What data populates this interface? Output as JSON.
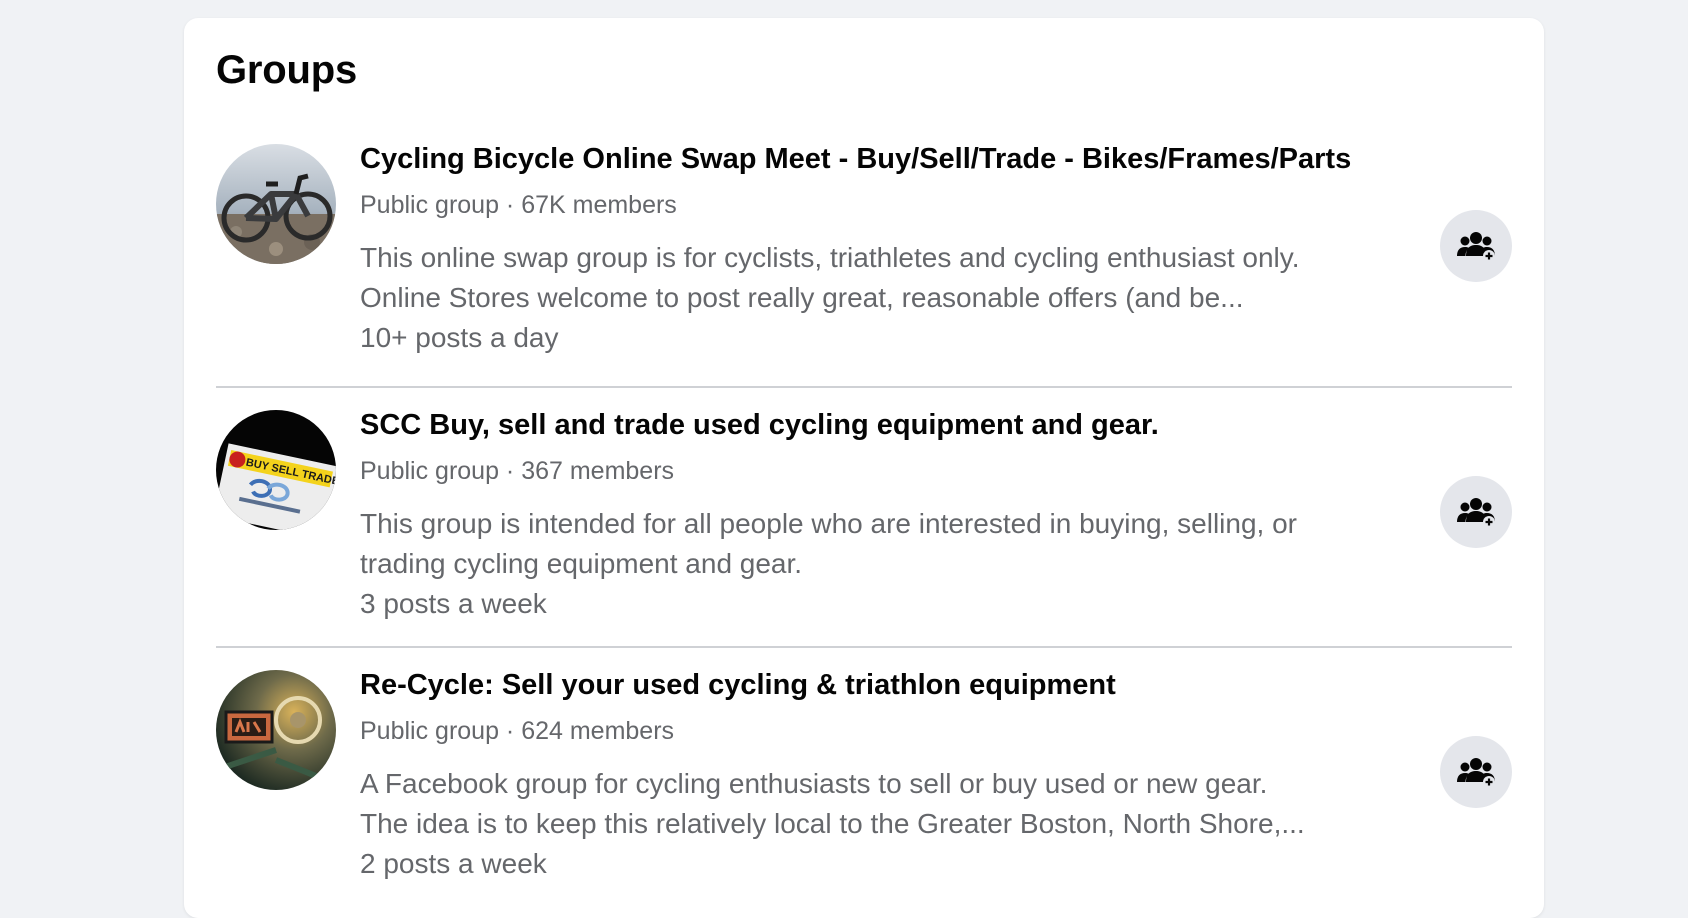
{
  "section": {
    "title": "Groups"
  },
  "groups": [
    {
      "name": "Cycling Bicycle Online Swap Meet - Buy/Sell/Trade - Bikes/Frames/Parts",
      "meta": "Public group · 67K members",
      "description_line1": "This online swap group is for cyclists, triathletes and cycling enthusiast only.",
      "description_line2": "Online Stores welcome to post really great, reasonable offers (and be...",
      "activity": "10+ posts a day",
      "avatar_icon": "bike-photo-avatar",
      "join_icon": "join-group-icon"
    },
    {
      "name": "SCC Buy, sell and trade used cycling equipment and gear.",
      "meta": "Public group · 367 members",
      "description_line1": "This group is intended for all people who are interested in buying, selling, or",
      "description_line2": "trading cycling equipment and gear.",
      "activity": "3 posts a week",
      "avatar_text": "BUY SELL TRADE",
      "avatar_icon": "buy-sell-trade-logo-avatar",
      "join_icon": "join-group-icon"
    },
    {
      "name": "Re-Cycle: Sell your used cycling & triathlon equipment",
      "meta": "Public group · 624 members",
      "description_line1": "A Facebook group for cycling enthusiasts to sell or buy used or new gear.",
      "description_line2": "The idea is to keep this relatively local to the Greater Boston, North Shore,...",
      "activity": "2 posts a week",
      "avatar_icon": "bike-shop-photo-avatar",
      "join_icon": "join-group-icon"
    }
  ],
  "colors": {
    "page_bg": "#f0f2f5",
    "card_bg": "#ffffff",
    "primary_text": "#050505",
    "secondary_text": "#65676b",
    "button_bg": "#e4e6eb",
    "divider": "#cfd1d5"
  }
}
